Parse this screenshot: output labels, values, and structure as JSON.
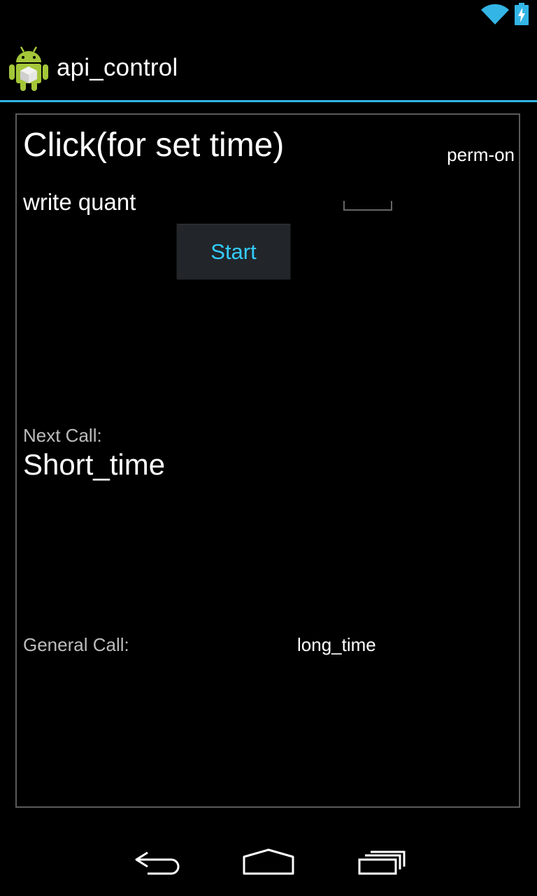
{
  "app": {
    "title": "api_control",
    "accent_color": "#33b5e5",
    "icon": "android-logo-icon"
  },
  "status_bar": {
    "icons": [
      "wifi-icon",
      "battery-charging-icon"
    ]
  },
  "main": {
    "heading": "Click(for set time)",
    "perm_status": "perm-on",
    "write_label": "write quant",
    "quant_value": "",
    "start_button": "Start",
    "next_call_label": "Next Call:",
    "next_call_value": "Short_time",
    "general_call_label": "General Call:",
    "general_call_value": "long_time"
  },
  "nav_bar": {
    "buttons": [
      "back-icon",
      "home-icon",
      "recent-apps-icon"
    ]
  }
}
